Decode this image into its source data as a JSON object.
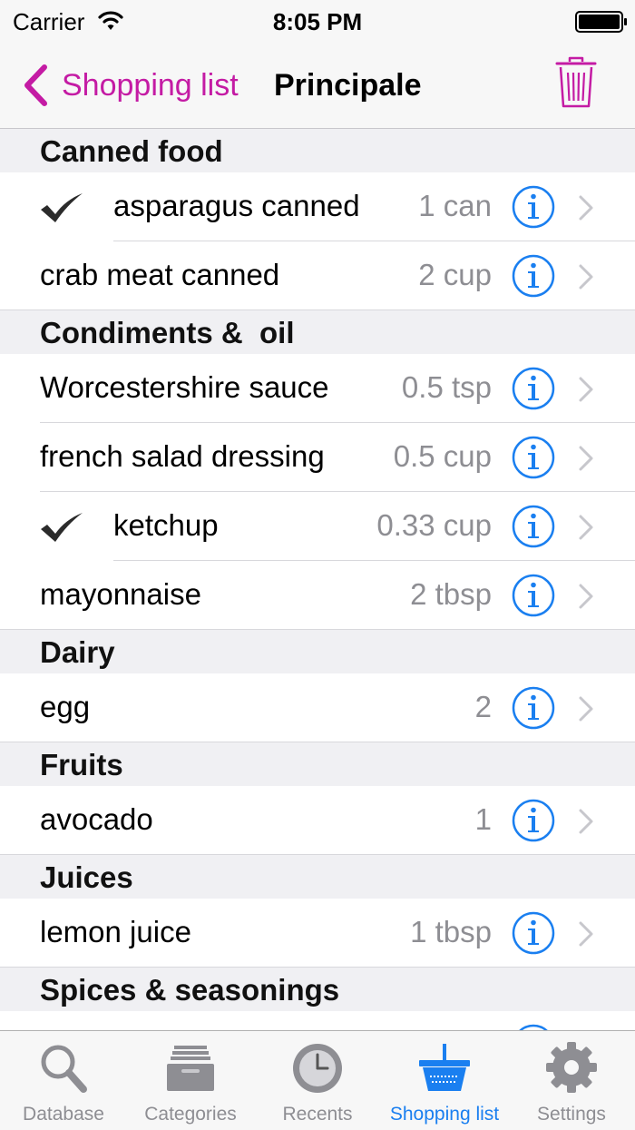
{
  "status_bar": {
    "carrier": "Carrier",
    "time": "8:05 PM"
  },
  "nav": {
    "back_label": "Shopping list",
    "title": "Principale"
  },
  "colors": {
    "accent": "#c41ba4",
    "info_blue": "#1a7ff0",
    "secondary_text": "#8e8e93"
  },
  "sections": [
    {
      "header": "Canned food",
      "items": [
        {
          "name": "asparagus canned",
          "qty": "1 can",
          "checked": true
        },
        {
          "name": "crab meat canned",
          "qty": "2 cup",
          "checked": false
        }
      ]
    },
    {
      "header": "Condiments &  oil",
      "items": [
        {
          "name": "Worcestershire sauce",
          "qty": "0.5 tsp",
          "checked": false
        },
        {
          "name": "french salad dressing",
          "qty": "0.5 cup",
          "checked": false
        },
        {
          "name": "ketchup",
          "qty": "0.33 cup",
          "checked": true
        },
        {
          "name": "mayonnaise",
          "qty": "2 tbsp",
          "checked": false
        }
      ]
    },
    {
      "header": "Dairy",
      "items": [
        {
          "name": "egg",
          "qty": "2",
          "checked": false
        }
      ]
    },
    {
      "header": "Fruits",
      "items": [
        {
          "name": "avocado",
          "qty": "1",
          "checked": false
        }
      ]
    },
    {
      "header": "Juices",
      "items": [
        {
          "name": "lemon juice",
          "qty": "1 tbsp",
          "checked": false
        }
      ]
    },
    {
      "header": "Spices & seasonings",
      "items": [
        {
          "name": "",
          "qty": "",
          "checked": false
        }
      ]
    }
  ],
  "tabs": [
    {
      "label": "Database",
      "icon": "magnifier-icon",
      "active": false
    },
    {
      "label": "Categories",
      "icon": "card-box-icon",
      "active": false
    },
    {
      "label": "Recents",
      "icon": "clock-icon",
      "active": false
    },
    {
      "label": "Shopping list",
      "icon": "basket-icon",
      "active": true
    },
    {
      "label": "Settings",
      "icon": "gear-icon",
      "active": false
    }
  ]
}
